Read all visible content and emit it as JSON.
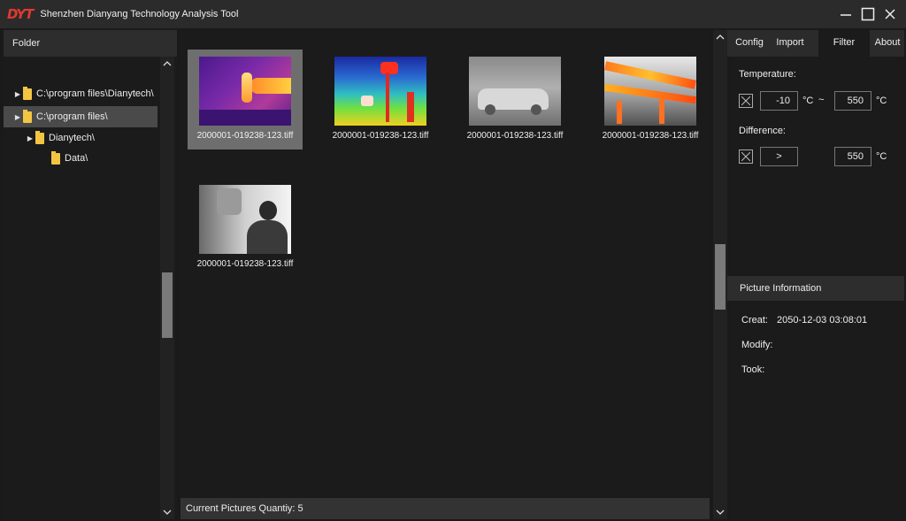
{
  "app": {
    "logo_text": "DYT",
    "title": "Shenzhen Dianyang Technology Analysis Tool"
  },
  "window_controls": {
    "minimize_icon": "minimize-icon",
    "maximize_icon": "maximize-icon",
    "close_icon": "close-icon"
  },
  "folder_panel": {
    "header": "Folder",
    "tree": [
      {
        "label": "C:\\program files\\Dianytech\\",
        "expanded": false,
        "selected": false
      },
      {
        "label": "C:\\program files\\",
        "expanded": false,
        "selected": true
      },
      {
        "label": "Dianytech\\",
        "expanded": false,
        "selected": false
      },
      {
        "label": "Data\\",
        "expanded": false,
        "selected": false
      }
    ]
  },
  "gallery": {
    "items": [
      {
        "name": "2000001-019238-123.tiff",
        "style": "ironbow-person",
        "selected": true
      },
      {
        "name": "2000001-019238-123.tiff",
        "style": "rainbow-lamp",
        "selected": false
      },
      {
        "name": "2000001-019238-123.tiff",
        "style": "gray-car",
        "selected": false
      },
      {
        "name": "2000001-019238-123.tiff",
        "style": "hot-pipes",
        "selected": false
      },
      {
        "name": "2000001-019238-123.tiff",
        "style": "gray-person",
        "selected": false
      }
    ],
    "status": "Current Pictures Quantiy: 5"
  },
  "right_panel": {
    "tabs": [
      {
        "label": "Config",
        "active": false
      },
      {
        "label": "Import",
        "active": false
      },
      {
        "label": "Filter",
        "active": true
      },
      {
        "label": "About",
        "active": false
      }
    ],
    "filter": {
      "temperature_label": "Temperature:",
      "temp_min": "-10",
      "temp_unit_1": "°C",
      "temp_separator": "~",
      "temp_max": "550",
      "temp_unit_2": "°C",
      "difference_label": "Difference:",
      "diff_operator": ">",
      "diff_value": "550",
      "diff_unit": "°C"
    },
    "info": {
      "header": "Picture Information",
      "creat_label": "Creat:",
      "creat_value": "2050-12-03 03:08:01",
      "modify_label": "Modify:",
      "took_label": "Took:"
    }
  },
  "colors": {
    "logo": "#e03a2e",
    "folder": "#f4c542",
    "selection": "#4a4a4a"
  }
}
